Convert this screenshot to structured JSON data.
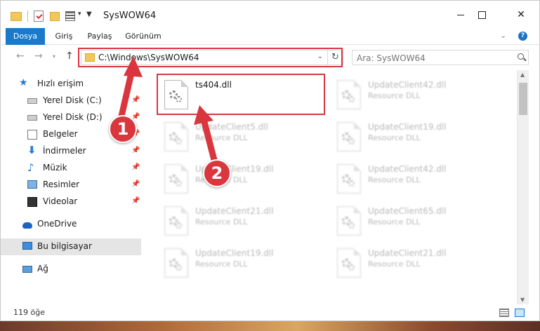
{
  "window": {
    "title": "SysWOW64",
    "minimize": "—",
    "maximize": "☐",
    "close": "✕"
  },
  "quick_access_toolbar": {
    "icons": [
      "folder-icon",
      "properties-icon",
      "new-folder-icon",
      "view-icon"
    ],
    "dropdown": "▾",
    "customize": "▼"
  },
  "ribbon": {
    "tabs": [
      {
        "label": "Dosya",
        "active": true
      },
      {
        "label": "Giriş"
      },
      {
        "label": "Paylaş"
      },
      {
        "label": "Görünüm"
      }
    ],
    "expand": "⌄",
    "help": "?"
  },
  "nav": {
    "back": "←",
    "forward": "→",
    "recent": "▾",
    "up": "↑",
    "address": "C:\\Windows\\SysWOW64",
    "address_dropdown": "⌄",
    "refresh": "↻",
    "search_placeholder": "Ara: SysWOW64"
  },
  "sidebar": {
    "items": [
      {
        "label": "Hızlı erişim",
        "icon": "star-icon"
      },
      {
        "label": "Yerel Disk (C:)",
        "icon": "drive-icon",
        "pinned": true
      },
      {
        "label": "Yerel Disk (D:)",
        "icon": "drive-icon",
        "pinned": true
      },
      {
        "label": "Belgeler",
        "icon": "documents-icon",
        "pinned": true
      },
      {
        "label": "İndirmeler",
        "icon": "downloads-icon",
        "pinned": true
      },
      {
        "label": "Müzik",
        "icon": "music-icon",
        "pinned": true
      },
      {
        "label": "Resimler",
        "icon": "pictures-icon",
        "pinned": true
      },
      {
        "label": "Videolar",
        "icon": "videos-icon",
        "pinned": true
      },
      {
        "label": "OneDrive",
        "icon": "onedrive-icon"
      },
      {
        "label": "Bu bilgisayar",
        "icon": "this-pc-icon",
        "selected": true
      },
      {
        "label": "Ağ",
        "icon": "network-icon"
      }
    ],
    "pin_glyph": "📌"
  },
  "files": [
    {
      "name": "ts404.dll",
      "type": ""
    },
    {
      "name": "UpdateClient42.dll",
      "type": "Resource DLL"
    },
    {
      "name": "UpdateClient5.dll",
      "type": "Resource DLL"
    },
    {
      "name": "UpdateClient19.dll",
      "type": "Resource DLL"
    },
    {
      "name": "UpdateClient19.dll",
      "type": "Resource DLL"
    },
    {
      "name": "UpdateClient42.dll",
      "type": "Resource DLL"
    },
    {
      "name": "UpdateClient21.dll",
      "type": "Resource DLL"
    },
    {
      "name": "UpdateClient65.dll",
      "type": "Resource DLL"
    },
    {
      "name": "UpdateClient19.dll",
      "type": "Resource DLL"
    },
    {
      "name": "UpdateClient21.dll",
      "type": "Resource DLL"
    }
  ],
  "status": {
    "item_count": "119 öğe"
  },
  "callouts": {
    "one": "1",
    "two": "2"
  },
  "colors": {
    "accent": "#1979ca",
    "annotation": "#d9363e"
  }
}
